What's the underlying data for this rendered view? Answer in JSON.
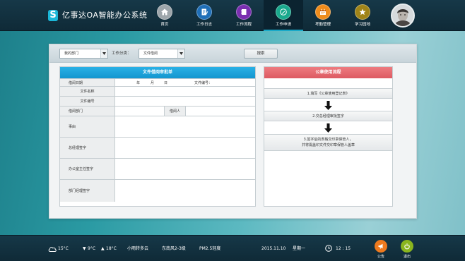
{
  "app": {
    "logo_letter": "S",
    "title": "亿事达OA智能办公系统"
  },
  "nav": [
    {
      "label": "首页",
      "icon": "home-icon",
      "color": "#9ea6ab"
    },
    {
      "label": "工作日志",
      "icon": "document-edit-icon",
      "color": "#1f6fb8"
    },
    {
      "label": "工作流程",
      "icon": "notebook-icon",
      "color": "#7a2fb0"
    },
    {
      "label": "工作申请",
      "icon": "pen-circle-icon",
      "color": "#1aa98d",
      "active": true
    },
    {
      "label": "考勤管理",
      "icon": "calendar-icon",
      "color": "#ef8c1b"
    },
    {
      "label": "学习园地",
      "icon": "star-icon",
      "color": "#a08418"
    }
  ],
  "filters": {
    "department": "我的部门",
    "category_label": "工作分类：",
    "category": "文件借阅",
    "search_label": "搜索"
  },
  "form": {
    "title": "文件借阅审批单",
    "borrow_date_label": "借阅日期",
    "date_year": "年",
    "date_month": "月",
    "date_day": "日",
    "doc_no_label": "文件编号：",
    "file_name_label": "文件名称",
    "file_no_label": "文件编号",
    "borrow_dept_label": "借阅部门",
    "borrower_label": "借阅人",
    "reason_label": "事由",
    "gm_sign_label": "总经理签字",
    "office_sign_label": "办公室主任签字",
    "dept_mgr_sign_label": "部门经理签字"
  },
  "flow": {
    "title": "公章使用流程",
    "steps": [
      "1.填写《公章使用登记表》",
      "2.交总经理审批签字",
      "3.签字后的表格交印章保管人，",
      "并将需盖印文件交印章保管人盖章"
    ]
  },
  "status": {
    "weather_temp": "15°C",
    "temp_low": "9°C",
    "temp_high": "18°C",
    "condition": "小雨转多云",
    "wind": "东南风2-3级",
    "air": "PM2.5轻度",
    "date": "2015.11.10",
    "weekday": "星期一",
    "time": "12 : 15"
  },
  "actions": {
    "notice_label": "公告",
    "notice_color": "#ee7a1e",
    "logout_label": "退出",
    "logout_color": "#8ab51e"
  }
}
